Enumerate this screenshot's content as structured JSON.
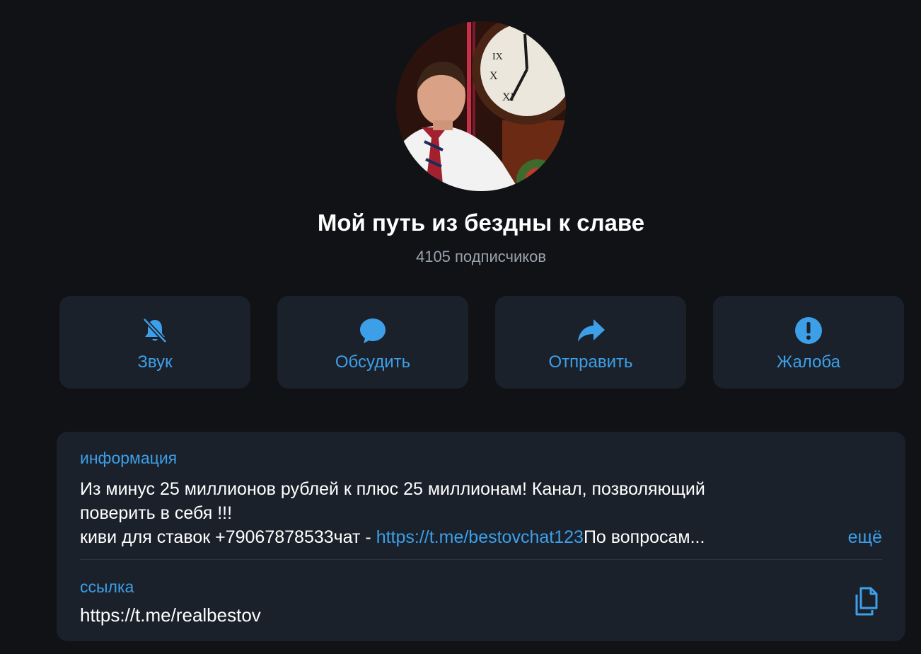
{
  "channel": {
    "title": "Мой путь из бездны к славе",
    "subscribers": "4105 подписчиков"
  },
  "actions": [
    {
      "label": "Звук",
      "icon": "bell-muted-icon"
    },
    {
      "label": "Обсудить",
      "icon": "chat-bubble-icon"
    },
    {
      "label": "Отправить",
      "icon": "share-arrow-icon"
    },
    {
      "label": "Жалоба",
      "icon": "alert-icon"
    }
  ],
  "info": {
    "header": "информация",
    "line1": "Из минус 25 миллионов рублей к плюс 25 миллионам! Канал, позволяющий",
    "line2": "поверить в себя !!!",
    "line3_prefix": "киви для ставок +79067878533чат - ",
    "line3_link": "https://t.me/bestovchat123",
    "line3_suffix": "По вопросам...",
    "more": "ещё"
  },
  "link": {
    "header": "ссылка",
    "value": "https://t.me/realbestov",
    "copy_icon": "copy-icon"
  },
  "colors": {
    "background": "#101216",
    "card": "#1a212b",
    "accent": "#3d9fe8",
    "text": "#ffffff",
    "muted": "#9ca3ab"
  }
}
